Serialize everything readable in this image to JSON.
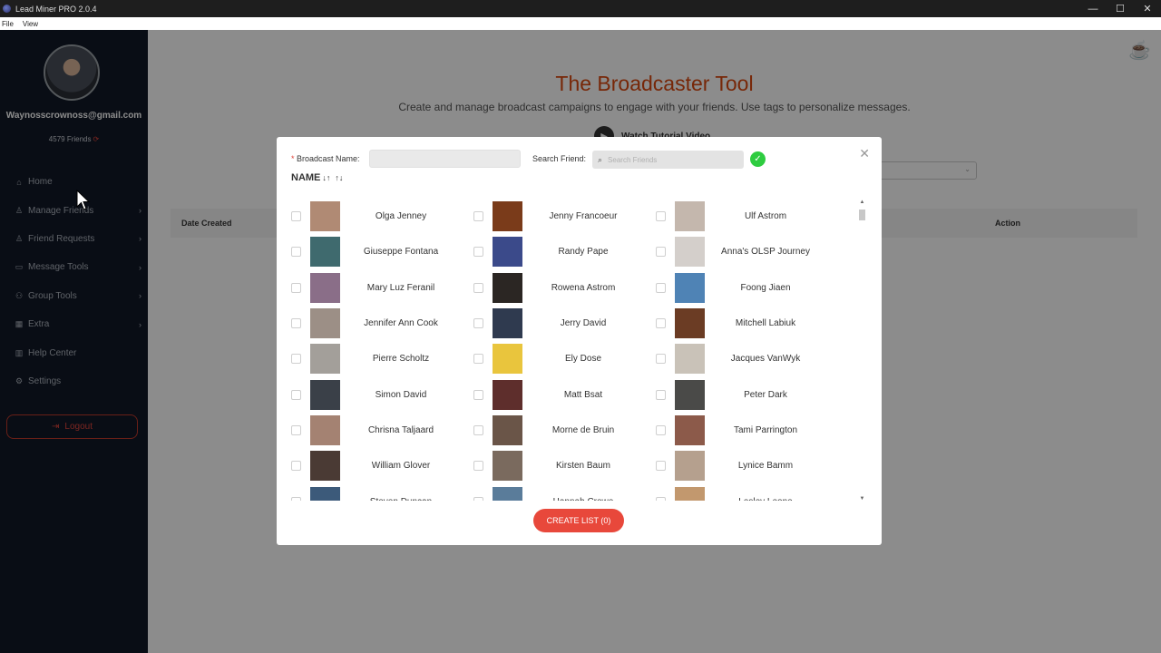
{
  "window": {
    "title": "Lead Miner PRO 2.0.4",
    "controls": {
      "minimize": "—",
      "maximize": "☐",
      "close": "✕"
    }
  },
  "menu": [
    "File",
    "View"
  ],
  "sidebar": {
    "email": "Waynosscrownoss@gmail.com",
    "friends": "4579 Friends",
    "items": [
      {
        "label": "Home",
        "icon": "home-icon",
        "glyph": "⌂",
        "chevron": false
      },
      {
        "label": "Manage Friends",
        "icon": "user-icon",
        "glyph": "♙",
        "chevron": true
      },
      {
        "label": "Friend Requests",
        "icon": "user-icon",
        "glyph": "♙",
        "chevron": true
      },
      {
        "label": "Message Tools",
        "icon": "message-icon",
        "glyph": "▭",
        "chevron": true
      },
      {
        "label": "Group Tools",
        "icon": "group-icon",
        "glyph": "⚇",
        "chevron": true
      },
      {
        "label": "Extra",
        "icon": "grid-icon",
        "glyph": "▦",
        "chevron": true
      },
      {
        "label": "Help Center",
        "icon": "book-icon",
        "glyph": "▥",
        "chevron": false
      },
      {
        "label": "Settings",
        "icon": "gear-icon",
        "glyph": "⚙",
        "chevron": false
      }
    ],
    "logout": "Logout"
  },
  "main": {
    "title": "The Broadcaster Tool",
    "subtitle": "Create and manage broadcast campaigns to engage with your friends. Use tags to personalize messages.",
    "tutorial": "Watch Tutorial Video",
    "table": {
      "col_date": "Date Created",
      "col_action": "Action"
    }
  },
  "modal": {
    "broadcast_label": "Broadcast Name:",
    "broadcast_value": "",
    "search_label": "Search Friend:",
    "search_placeholder": "Search Friends",
    "sort_label": "NAME",
    "create_button": "CREATE LIST (0)",
    "friends": [
      {
        "name": "Olga Jenney",
        "color": "#b08a74"
      },
      {
        "name": "Jenny Francoeur",
        "color": "#7a3b1a"
      },
      {
        "name": "Ulf Astrom",
        "color": "#c4b7ad"
      },
      {
        "name": "Giuseppe Fontana",
        "color": "#3f6a6e"
      },
      {
        "name": "Randy Pape",
        "color": "#3b4a8a"
      },
      {
        "name": "Anna's OLSP Journey",
        "color": "#d4cfcb"
      },
      {
        "name": "Mary Luz Feranil",
        "color": "#8a6e88"
      },
      {
        "name": "Rowena Astrom",
        "color": "#2b2623"
      },
      {
        "name": "Foong Jiaen",
        "color": "#4f83b5"
      },
      {
        "name": "Jennifer Ann Cook",
        "color": "#9c8f86"
      },
      {
        "name": "Jerry David",
        "color": "#2f3a4f"
      },
      {
        "name": "Mitchell Labiuk",
        "color": "#6b3c24"
      },
      {
        "name": "Pierre Scholtz",
        "color": "#a39f9a"
      },
      {
        "name": "Ely Dose",
        "color": "#e9c53d"
      },
      {
        "name": "Jacques VanWyk",
        "color": "#c9c2b8"
      },
      {
        "name": "Simon David",
        "color": "#3a4048"
      },
      {
        "name": "Matt Bsat",
        "color": "#5e2e2c"
      },
      {
        "name": "Peter Dark",
        "color": "#4a4a48"
      },
      {
        "name": "Chrisna Taljaard",
        "color": "#a48272"
      },
      {
        "name": "Morne de Bruin",
        "color": "#6a5548"
      },
      {
        "name": "Tami Parrington",
        "color": "#8c5a4a"
      },
      {
        "name": "William Glover",
        "color": "#4a3a34"
      },
      {
        "name": "Kirsten Baum",
        "color": "#7a6a5e"
      },
      {
        "name": "Lynice Bamm",
        "color": "#b5a08e"
      },
      {
        "name": "Steven Duncan",
        "color": "#3c5a7a"
      },
      {
        "name": "Hannah Crowe",
        "color": "#5a7c9a"
      },
      {
        "name": "Lesley Leone",
        "color": "#c2986e"
      }
    ]
  }
}
